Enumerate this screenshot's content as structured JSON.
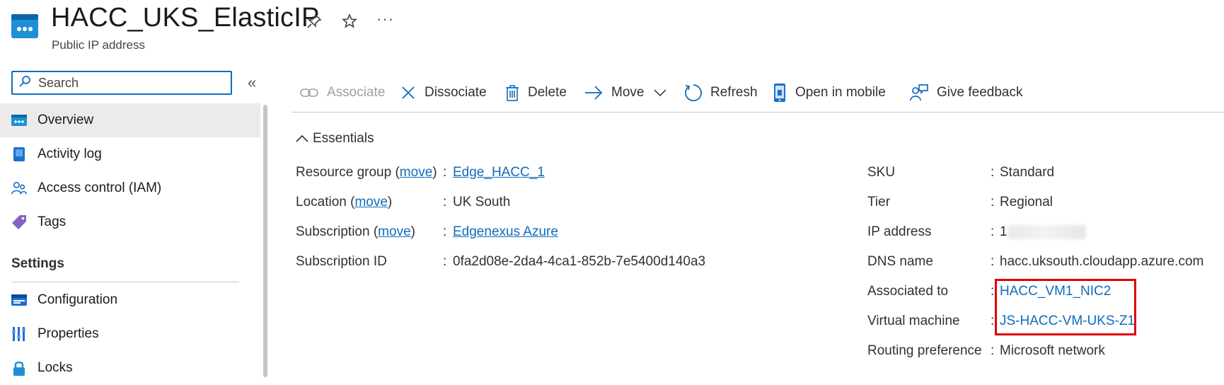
{
  "header": {
    "title": "HACC_UKS_ElasticIP",
    "subtitle": "Public IP address",
    "more_label": "···"
  },
  "search": {
    "placeholder": "Search",
    "value": "",
    "collapse_glyph": "«"
  },
  "sidebar": {
    "items": [
      {
        "label": "Overview",
        "icon": "overview-icon",
        "active": true
      },
      {
        "label": "Activity log",
        "icon": "activity-log-icon"
      },
      {
        "label": "Access control (IAM)",
        "icon": "iam-icon"
      },
      {
        "label": "Tags",
        "icon": "tag-icon"
      }
    ],
    "settings_heading": "Settings",
    "settings_items": [
      {
        "label": "Configuration",
        "icon": "configuration-icon"
      },
      {
        "label": "Properties",
        "icon": "properties-icon"
      },
      {
        "label": "Locks",
        "icon": "lock-icon"
      }
    ]
  },
  "toolbar": {
    "associate": "Associate",
    "dissociate": "Dissociate",
    "delete": "Delete",
    "move": "Move",
    "refresh": "Refresh",
    "open_mobile": "Open in mobile",
    "feedback": "Give feedback"
  },
  "essentials": {
    "heading": "Essentials",
    "left": {
      "resource_group_label": "Resource group (",
      "resource_group_move": "move",
      "resource_group_close": ")",
      "resource_group_value": "Edge_HACC_1",
      "location_label": "Location (",
      "location_move": "move",
      "location_close": ")",
      "location_value": "UK South",
      "subscription_label": "Subscription (",
      "subscription_move": "move",
      "subscription_close": ")",
      "subscription_value": "Edgenexus Azure",
      "subscription_id_label": "Subscription ID",
      "subscription_id_value": "0fa2d08e-2da4-4ca1-852b-7e5400d140a3"
    },
    "right": {
      "sku_label": "SKU",
      "sku_value": "Standard",
      "tier_label": "Tier",
      "tier_value": "Regional",
      "ip_label": "IP address",
      "ip_value": "1",
      "dns_label": "DNS name",
      "dns_value": "hacc.uksouth.cloudapp.azure.com",
      "assoc_label": "Associated to",
      "assoc_value": "HACC_VM1_NIC2",
      "vm_label": "Virtual machine",
      "vm_value": "JS-HACC-VM-UKS-Z1",
      "routing_label": "Routing preference",
      "routing_value": "Microsoft network"
    },
    "colon": ":"
  },
  "colors": {
    "accent": "#0f6cbd",
    "highlight": "#e00000"
  }
}
